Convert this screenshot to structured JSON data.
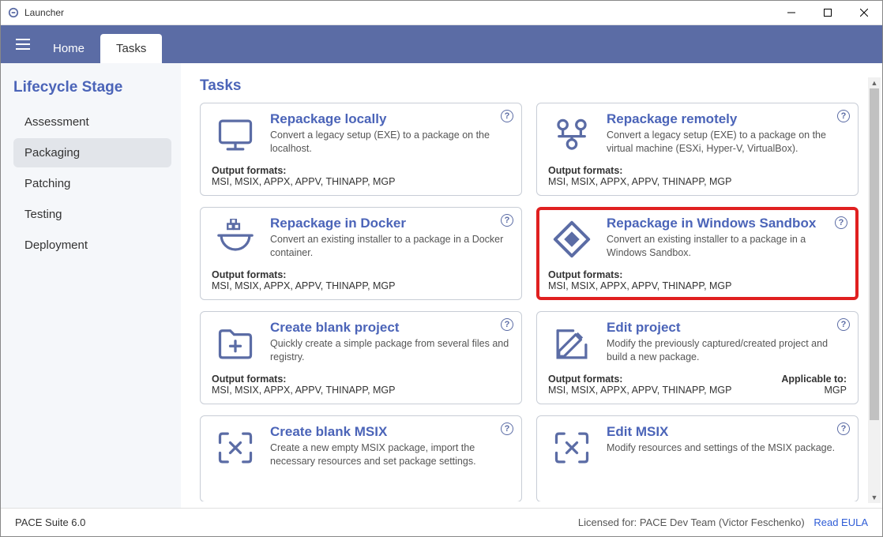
{
  "window": {
    "title": "Launcher"
  },
  "tabs": {
    "home": "Home",
    "tasks": "Tasks"
  },
  "sidebar": {
    "heading": "Lifecycle Stage",
    "stages": [
      "Assessment",
      "Packaging",
      "Patching",
      "Testing",
      "Deployment"
    ],
    "active_index": 1
  },
  "main": {
    "heading": "Tasks",
    "output_formats_label": "Output formats:",
    "applicable_to_label": "Applicable to:",
    "cards": [
      {
        "id": "repackage-locally",
        "title": "Repackage locally",
        "desc": "Convert a legacy setup (EXE) to a package on the localhost.",
        "formats": "MSI, MSIX, APPX, APPV, THINAPP, MGP",
        "icon": "monitor"
      },
      {
        "id": "repackage-remotely",
        "title": "Repackage remotely",
        "desc": "Convert a legacy setup (EXE) to a package on the virtual machine (ESXi, Hyper-V, VirtualBox).",
        "formats": "MSI, MSIX, APPX, APPV, THINAPP, MGP",
        "icon": "network"
      },
      {
        "id": "repackage-docker",
        "title": "Repackage in Docker",
        "desc": "Convert an existing installer to a package in a Docker container.",
        "formats": "MSI, MSIX, APPX, APPV, THINAPP, MGP",
        "icon": "docker"
      },
      {
        "id": "repackage-sandbox",
        "title": "Repackage in Windows Sandbox",
        "desc": "Convert an existing installer to a package in a Windows Sandbox.",
        "formats": "MSI, MSIX, APPX, APPV, THINAPP, MGP",
        "icon": "diamond",
        "highlight": true
      },
      {
        "id": "create-blank-project",
        "title": "Create blank project",
        "desc": "Quickly create a simple package from several files and registry.",
        "formats": "MSI, MSIX, APPX, APPV, THINAPP, MGP",
        "icon": "folder-plus"
      },
      {
        "id": "edit-project",
        "title": "Edit project",
        "desc": "Modify the previously captured/created project and build a new package.",
        "formats": "MSI, MSIX, APPX, APPV, THINAPP, MGP",
        "applicable": "MGP",
        "icon": "edit"
      },
      {
        "id": "create-blank-msix",
        "title": "Create blank MSIX",
        "desc": "Create a new empty MSIX package, import the necessary resources and set package settings.",
        "icon": "bracket-x"
      },
      {
        "id": "edit-msix",
        "title": "Edit MSIX",
        "desc": "Modify resources and settings of the MSIX package.",
        "icon": "bracket-x"
      }
    ]
  },
  "footer": {
    "version": "PACE Suite 6.0",
    "license": "Licensed for: PACE Dev Team (Victor Feschenko)",
    "eula": "Read EULA"
  }
}
